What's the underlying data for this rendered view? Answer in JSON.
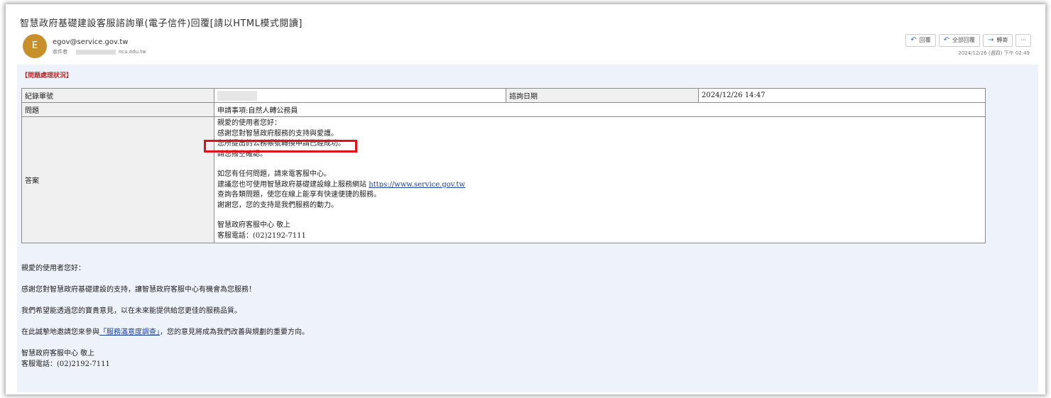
{
  "email": {
    "subject": "智慧政府基礎建設客服諮詢單(電子信件)回覆[請以HTML模式閱讀]",
    "avatar_letter": "E",
    "sender": "egov@service.gov.tw",
    "recipient_label": "收件者",
    "recipient_visible": "ncu.edu.tw",
    "date": "2024/12/26 (週四) 下午 02:49",
    "actions": {
      "reply": "回覆",
      "reply_all": "全部回覆",
      "forward": "轉寄",
      "more": "···"
    }
  },
  "section_label": "【問題處理狀況】",
  "table": {
    "record_label": "紀錄單號",
    "inquiry_date_label": "諮詢日期",
    "inquiry_date": "2024/12/26 14:47",
    "question_label": "問題",
    "question_value": "申請事項:自然人轉公務員",
    "answer_label": "答案",
    "answer_lines": {
      "l1": "親愛的使用者您好：",
      "l2": "感謝您對智慧政府服務的支持與愛護。",
      "l3": "您所提出的公務帳號轉換申請已經成功。",
      "l4": "請您撥空確認。",
      "l5": "如您有任何問題，請來電客服中心。",
      "l6": "建議您也可使用智慧政府基礎建設線上服務網站",
      "l6_link": "https://www.service.gov.tw",
      "l7": "查詢各類問題，使您在線上能享有快速便捷的服務。",
      "l8": "謝謝您，您的支持是我們服務的動力。",
      "l9": "智慧政府客服中心 敬上",
      "l10": "客服電話：(02)2192-7111"
    }
  },
  "footer": {
    "greeting": "親愛的使用者您好：",
    "thanks": "感謝您對智慧政府基礎建設的支持，讓智慧政府客服中心有機會為您服務！",
    "hope": "我們希望能透過您的寶貴意見，以在未來能提供給您更佳的服務品質。",
    "invite_before": "在此誠摯地邀請您來參與",
    "invite_link": "「服務滿意度調查」",
    "invite_after": "，您的意見將成為我們改善與規劃的重要方向。",
    "sign1": "智慧政府客服中心 敬上",
    "sign2": "客服電話：(02)2192-7111"
  },
  "colors": {
    "avatar": "#c8902a",
    "highlight": "#e3101a",
    "body_bg": "#eef3fb",
    "link": "#1a3f9b"
  }
}
